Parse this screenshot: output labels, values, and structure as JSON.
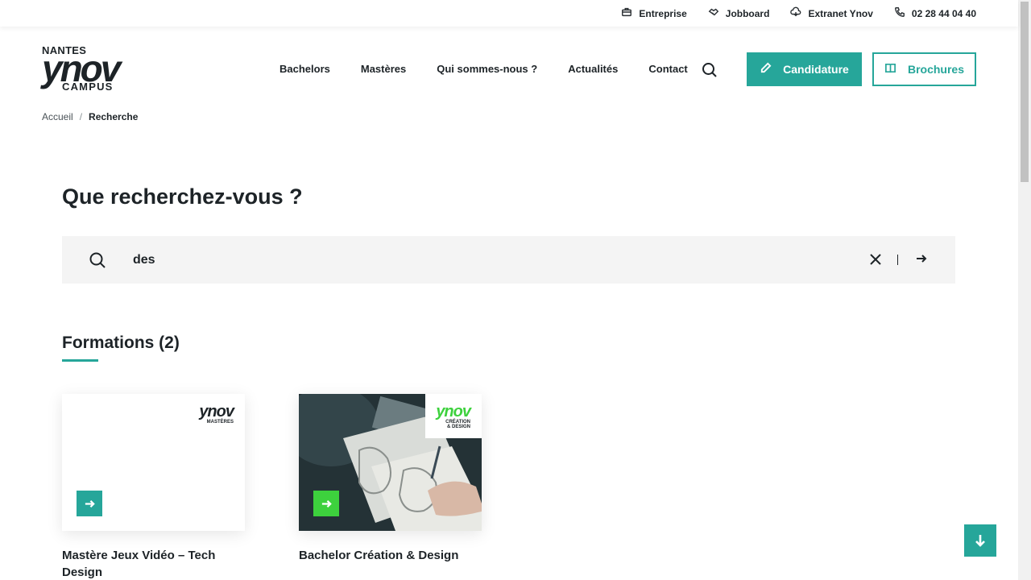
{
  "topbar": {
    "links": [
      {
        "label": "Entreprise",
        "icon": "briefcase-icon"
      },
      {
        "label": "Jobboard",
        "icon": "handshake-icon"
      },
      {
        "label": "Extranet Ynov",
        "icon": "cloud-icon"
      },
      {
        "label": "02 28 44 04 40",
        "icon": "phone-icon"
      }
    ]
  },
  "logo": {
    "city": "NANTES",
    "brand": "ynov",
    "sub": "CAMPUS"
  },
  "nav": {
    "items": [
      "Bachelors",
      "Mastères",
      "Qui sommes-nous ?",
      "Actualités",
      "Contact"
    ]
  },
  "buttons": {
    "candidature": "Candidature",
    "brochures": "Brochures"
  },
  "breadcrumb": {
    "home": "Accueil",
    "separator": "/",
    "current": "Recherche"
  },
  "search": {
    "title": "Que recherchez-vous ?",
    "query": "des"
  },
  "results": {
    "section_title": "Formations (2)",
    "cards": [
      {
        "name": "Mastère Jeux Vidéo – Tech Design",
        "badge_brand": "ynov",
        "badge_sub": "MASTÈRES",
        "badge_color": "#1d2327",
        "button_color": "#26a69a"
      },
      {
        "name": "Bachelor Création & Design",
        "badge_brand": "ynov",
        "badge_sub": "CRÉATION & DESIGN",
        "badge_color": "#3dd13d",
        "button_color": "#3dd13d"
      }
    ]
  },
  "colors": {
    "accent": "#26a69a",
    "text": "#1d2327",
    "search_bg": "#f4f4f4"
  }
}
